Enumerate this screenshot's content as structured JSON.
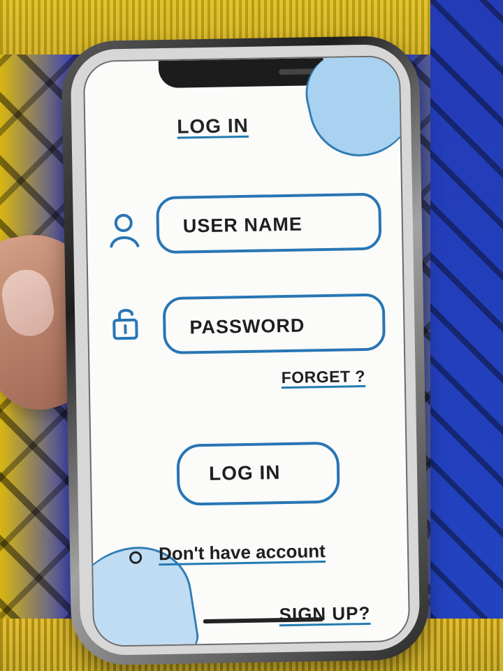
{
  "screen": {
    "title": "LOG IN",
    "fields": [
      {
        "label": "USER NAME",
        "icon": "user-icon"
      },
      {
        "label": "PASSWORD",
        "icon": "lock-icon"
      }
    ],
    "forgot_link": "FORGET ?",
    "login_button": "LOG IN",
    "account_prompt": "Don't have account",
    "signup_link": "SIGN UP?"
  },
  "colors": {
    "accent": "#2876b5",
    "text": "#1f1f1f",
    "screen": "#fbfbfa",
    "blob": "#a9d2f0"
  }
}
